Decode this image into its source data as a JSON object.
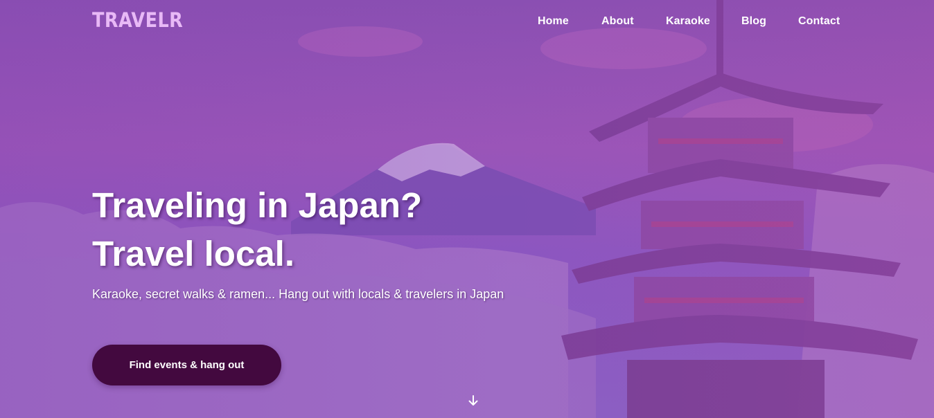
{
  "brand": {
    "name": "TRAVELR"
  },
  "nav": {
    "items": [
      {
        "label": "Home"
      },
      {
        "label": "About"
      },
      {
        "label": "Karaoke"
      },
      {
        "label": "Blog"
      },
      {
        "label": "Contact"
      }
    ]
  },
  "hero": {
    "headline_line1": "Traveling in Japan?",
    "headline_line2": "Travel local.",
    "subtitle": "Karaoke, secret walks & ramen... Hang out with locals & travelers in Japan",
    "cta_label": "Find events & hang out",
    "scroll_icon": "arrow-down-icon"
  },
  "colors": {
    "brand": "#e8b9f6",
    "overlay": "#9a55b8",
    "cta_background": "#43093f",
    "text": "#ffffff"
  }
}
